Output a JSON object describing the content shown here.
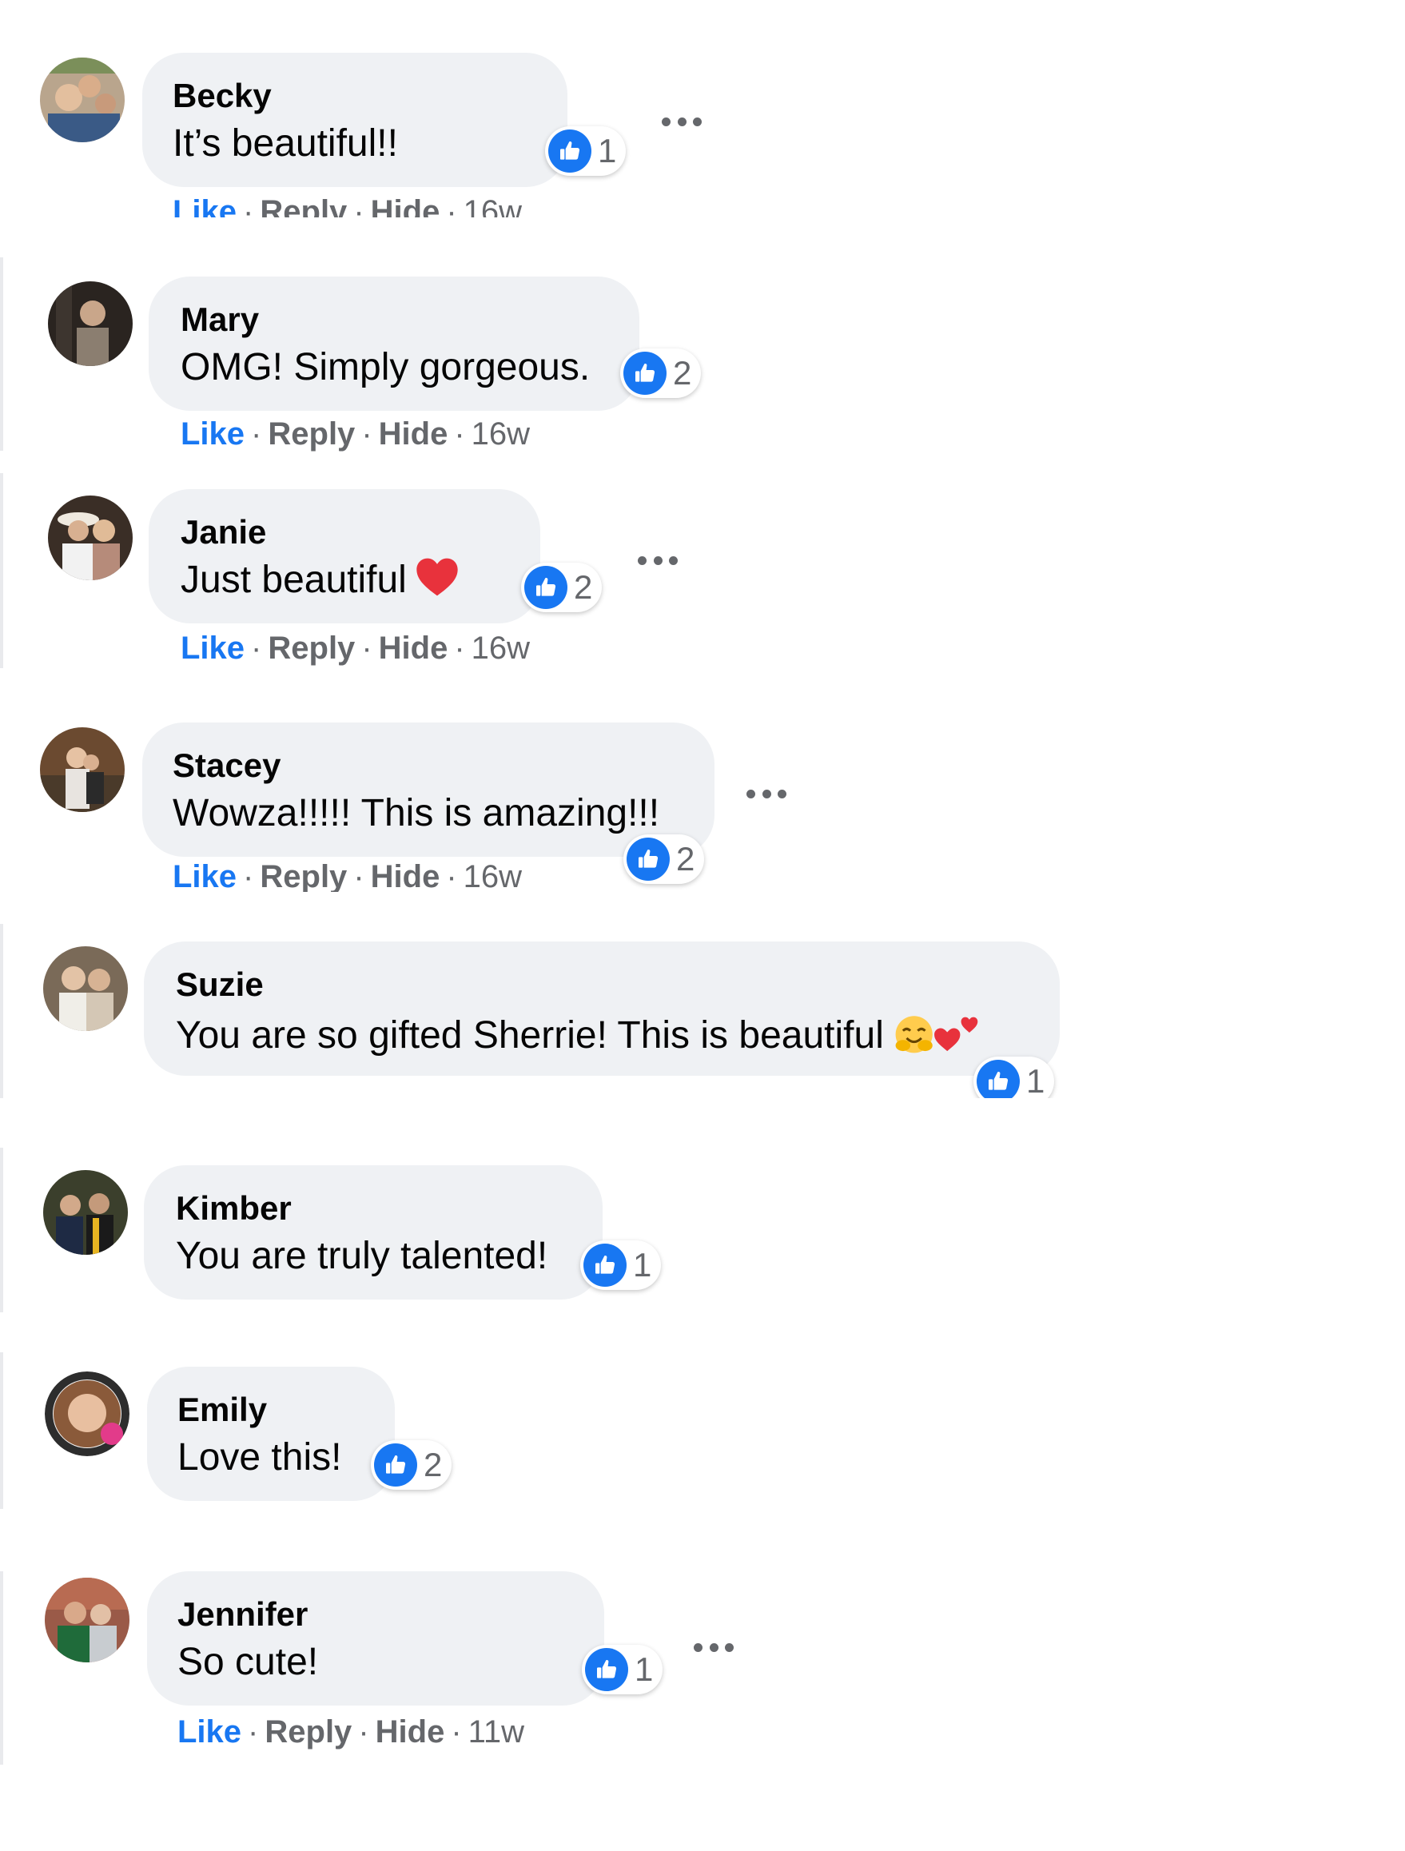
{
  "actions": {
    "like": "Like",
    "reply": "Reply",
    "hide": "Hide",
    "separator": "·"
  },
  "colors": {
    "bubble": "#eff1f4",
    "like_blue": "#1877f2",
    "meta_gray": "#65676b",
    "name_black": "#050505"
  },
  "reaction_type": "thumbs-up-like",
  "comments": [
    {
      "name": "Becky",
      "text": "It’s beautiful!!",
      "likes": "1",
      "time": "16w",
      "has_more_menu": true
    },
    {
      "name": "Mary",
      "text": "OMG! Simply gorgeous.",
      "likes": "2",
      "time": "16w",
      "has_more_menu": false
    },
    {
      "name": "Janie",
      "text": "Just beautiful",
      "emoji": "red-heart-icon",
      "likes": "2",
      "time": "16w",
      "has_more_menu": true
    },
    {
      "name": "Stacey",
      "text": "Wowza!!!!! This is amazing!!!",
      "likes": "2",
      "time": "16w",
      "has_more_menu": true
    },
    {
      "name": "Suzie",
      "text": "You are so gifted Sherrie! This is beautiful",
      "emoji": "smiling-face-with-open-hands-and-two-hearts-icon",
      "likes": "1",
      "has_more_menu": false
    },
    {
      "name": "Kimber",
      "text": "You are truly talented!",
      "likes": "1",
      "has_more_menu": false
    },
    {
      "name": "Emily",
      "text": "Love this!",
      "likes": "2",
      "has_more_menu": false
    },
    {
      "name": "Jennifer",
      "text": "So cute!",
      "likes": "1",
      "time": "11w",
      "has_more_menu": true
    }
  ]
}
